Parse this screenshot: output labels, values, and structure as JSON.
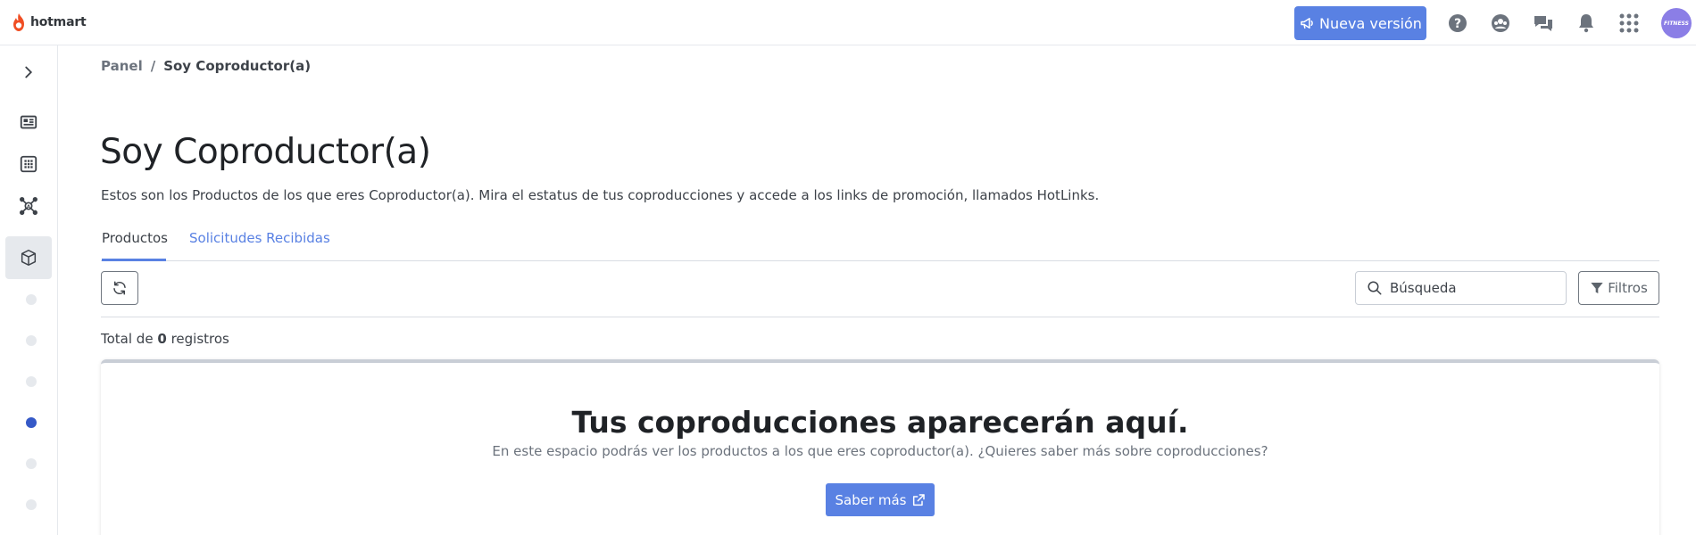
{
  "brand": {
    "name": "hotmart",
    "accent": "#5981e3",
    "logo_color": "#f04e23"
  },
  "header": {
    "new_version_label": "Nueva versión",
    "icons": [
      "help-icon",
      "community-icon",
      "chat-icon",
      "bell-icon",
      "apps-grid-icon"
    ],
    "avatar_text": "FITNESS"
  },
  "sidebar": {
    "items": [
      {
        "icon": "chevron-right-icon",
        "active": false
      },
      {
        "icon": "dashboard-icon",
        "active": false
      },
      {
        "icon": "grid-icon",
        "active": false
      },
      {
        "icon": "affiliate-network-icon",
        "active": false
      },
      {
        "icon": "box-icon",
        "active": true
      }
    ],
    "dots": [
      false,
      false,
      false,
      true,
      false,
      false
    ]
  },
  "breadcrumb": {
    "root": "Panel",
    "separator": "/",
    "current": "Soy Coproductor(a)"
  },
  "page": {
    "title": "Soy Coproductor(a)",
    "description": "Estos son los Productos de los que eres Coproductor(a). Mira el estatus de tus coproducciones y accede a los links de promoción, llamados HotLinks."
  },
  "tabs": [
    {
      "label": "Productos",
      "active": true
    },
    {
      "label": "Solicitudes Recibidas",
      "active": false
    }
  ],
  "toolbar": {
    "search_placeholder": "Búsqueda",
    "filters_label": "Filtros"
  },
  "total": {
    "prefix": "Total de",
    "count": "0",
    "suffix": "registros"
  },
  "empty_state": {
    "title": "Tus coproducciones aparecerán aquí.",
    "text": "En este espacio podrás ver los productos a los que eres coproductor(a). ¿Quieres saber más sobre coproducciones?",
    "button_label": "Saber más"
  }
}
